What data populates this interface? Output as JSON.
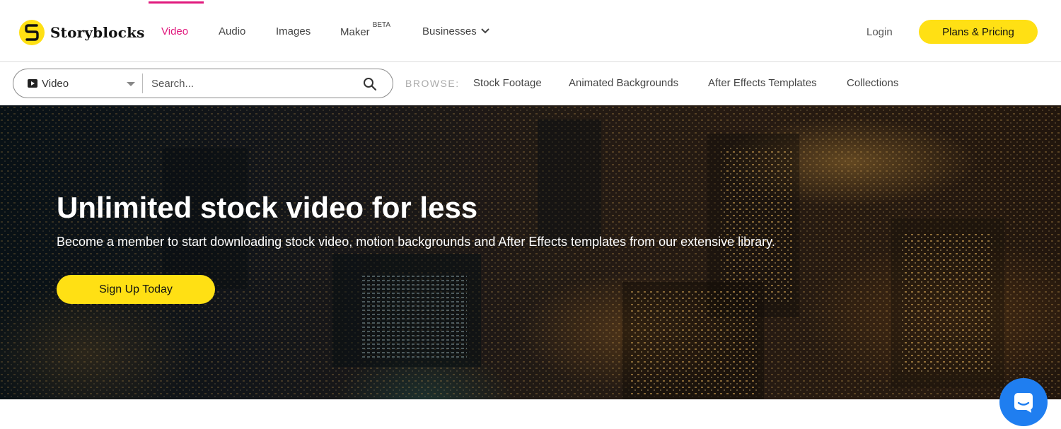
{
  "brand": {
    "name": "Storyblocks",
    "accent": "#e0197d",
    "yellow": "#ffe014"
  },
  "nav": {
    "items": [
      {
        "label": "Video",
        "active": true
      },
      {
        "label": "Audio"
      },
      {
        "label": "Images"
      },
      {
        "label": "Maker",
        "badge": "BETA"
      },
      {
        "label": "Businesses",
        "icon": "chevron-down-icon"
      }
    ],
    "login": "Login",
    "plans_cta": "Plans & Pricing"
  },
  "search": {
    "type_selected": "Video",
    "type_icon": "video-play-icon",
    "placeholder": "Search...",
    "value": ""
  },
  "browse": {
    "label": "BROWSE:",
    "links": [
      "Stock Footage",
      "Animated Backgrounds",
      "After Effects Templates",
      "Collections"
    ]
  },
  "hero": {
    "title": "Unlimited stock video for less",
    "subtitle": "Become a member to start downloading stock video, motion backgrounds and After Effects templates from our extensive library.",
    "cta": "Sign Up Today"
  },
  "chat": {
    "icon": "chat-icon",
    "color": "#1f7ef0"
  }
}
